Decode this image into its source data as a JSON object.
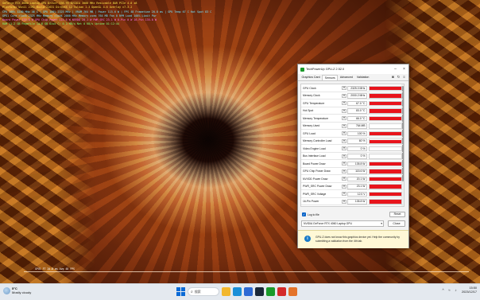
{
  "osd": {
    "lines": [
      {
        "text": "GeForce RTX 4060 Laptop GPU  Driver 536.99  NVIDIA 3000 MHz  Resizable BAR  PCIe 4.0 x8",
        "color": "yellow"
      },
      {
        "text": "Platform: Win11 23H2  Build 22631  DirectX 12  Vulkan 1.3  OpenGL 4.6  Overlay v7.3.2",
        "color": "yellow"
      },
      {
        "text": "CPU 100% 3200 MHz  46 C  | GPU 100% 2325 MHz  | VRAM 764 MB  | Power 115.6 W  | FPS 48  Frametime 20.8 ms  | GPU Temp 67 C  Hot Spot 83 C",
        "color": "cyan"
      },
      {
        "text": "GPU1  Core clock 2325 MHz  Memory clock 2000 MHz  Memory used 764 MB  Fan 0 RPM  Load 100%  Limit Pwr",
        "color": "cyan"
      },
      {
        "text": "Board Power 135.8 W  GPU Chip Power 115.6 W  NVVDD 20.1 W  PWR_SRC 23.1 W  8-Pin 0 W  16-Pin 135.8 W",
        "color": "magenta"
      },
      {
        "text": "RAM 11.2 GB  Pagefile 14.6 GB  Disk C: 0.3 MB/s  Net 0 KB/s  Uptime 01:12:44",
        "color": "green"
      }
    ]
  },
  "graph": {
    "label": "GPU1 FT 20.8 ms  Avg 48 FPS"
  },
  "gpuz": {
    "title": "TechPowerUp GPU-Z 2.52.0",
    "tabs": [
      "Graphics Card",
      "Sensors",
      "Advanced",
      "Validation"
    ],
    "active_tab": "Sensors",
    "tool_icons": [
      "camera-icon",
      "refresh-icon",
      "menu-icon"
    ],
    "sensors": [
      {
        "name": "GPU Clock",
        "value": "2325.0 MHz",
        "level": 0.95
      },
      {
        "name": "Memory Clock",
        "value": "2000.2 MHz",
        "level": 0.92
      },
      {
        "name": "GPU Temperature",
        "value": "67.0 °C",
        "level": 0.85
      },
      {
        "name": "Hot Spot",
        "value": "83.0 °C",
        "level": 0.9
      },
      {
        "name": "Memory Temperature",
        "value": "66.0 °C",
        "level": 0.85
      },
      {
        "name": "Memory Used",
        "value": "764 MB",
        "level": 0.0
      },
      {
        "name": "GPU Load",
        "value": "100 %",
        "level": 1.0
      },
      {
        "name": "Memory Controller Load",
        "value": "60 %",
        "level": 0.85
      },
      {
        "name": "Video Engine Load",
        "value": "0 %",
        "level": 0.0
      },
      {
        "name": "Bus Interface Load",
        "value": "0 %",
        "level": 0.0
      },
      {
        "name": "Board Power Draw",
        "value": "135.8 W",
        "level": 1.0
      },
      {
        "name": "GPU Chip Power Draw",
        "value": "115.6 W",
        "level": 1.0
      },
      {
        "name": "NVVDD Power Draw",
        "value": "20.1 W",
        "level": 1.0
      },
      {
        "name": "PWR_SRC Power Draw",
        "value": "23.1 W",
        "level": 1.0
      },
      {
        "name": "PWR_SRC Voltage",
        "value": "12.0 V",
        "level": 1.0
      },
      {
        "name": "16-Pin Power",
        "value": "135.8 W",
        "level": 1.0
      }
    ],
    "log_label": "Log to file",
    "reset_label": "Reset",
    "gpu_select": "NVIDIA GeForce RTX 4060 Laptop GPU",
    "close_label": "Close",
    "warning": "GPU-Z does not know this graphics device yet. Help the community by submitting a validation from the 4th tab."
  },
  "taskbar": {
    "weather_temp": "5°C",
    "weather_desc": "Mostly cloudy",
    "search_label": "搜索",
    "apps": [
      {
        "name": "file-explorer-icon",
        "color": "#f2b72e"
      },
      {
        "name": "edge-icon",
        "color": "#1a8fd8"
      },
      {
        "name": "store-icon",
        "color": "#2e6ad4"
      },
      {
        "name": "steam-icon",
        "color": "#1b2838"
      },
      {
        "name": "gpuz-taskbar-icon",
        "color": "#1a9a2a"
      },
      {
        "name": "app-red-icon",
        "color": "#d42a2a"
      },
      {
        "name": "app-orange-icon",
        "color": "#e4732a"
      }
    ],
    "time": "15:50",
    "date": "2023/12/17"
  }
}
